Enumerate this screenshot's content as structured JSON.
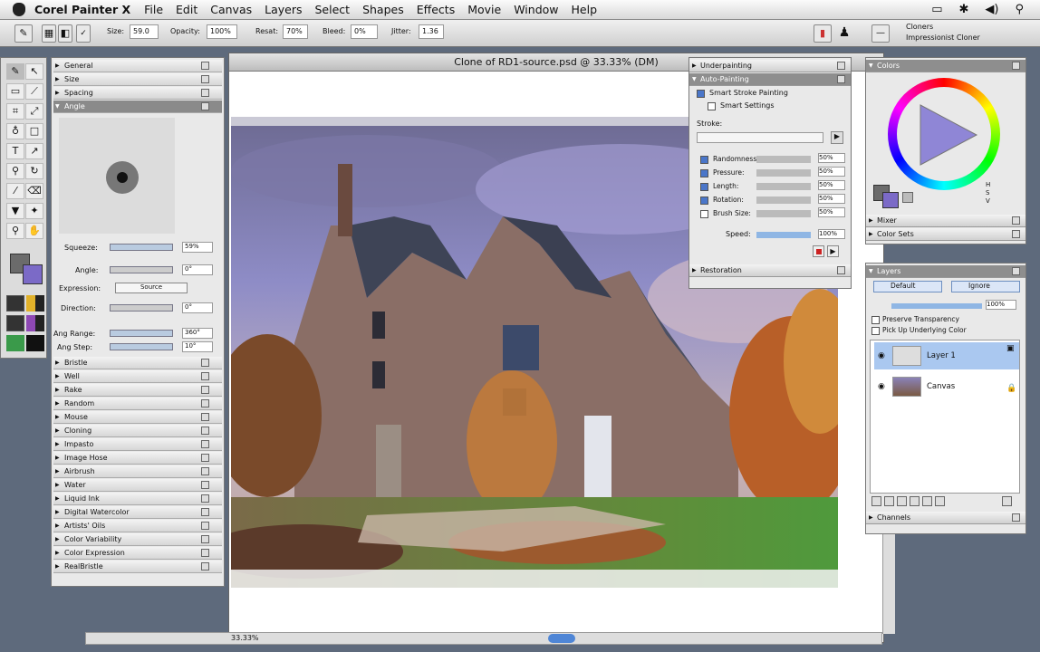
{
  "menubar": {
    "app": "Corel Painter X",
    "items": [
      "File",
      "Edit",
      "Canvas",
      "Layers",
      "Select",
      "Shapes",
      "Effects",
      "Movie",
      "Window",
      "Help"
    ]
  },
  "propbar": {
    "size_label": "Size:",
    "size_value": "59.0",
    "opacity_label": "Opacity:",
    "opacity_value": "100%",
    "resat_label": "Resat:",
    "resat_value": "70%",
    "bleed_label": "Bleed:",
    "bleed_value": "0%",
    "jitter_label": "Jitter:",
    "jitter_value": "1.36",
    "brush_category": "Cloners",
    "brush_variant": "Impressionist Cloner"
  },
  "canvas": {
    "title": "Clone of RD1-source.psd @ 33.33% (DM)",
    "zoom": "33.33%"
  },
  "brush_controls": {
    "sections_top": [
      "General",
      "Size",
      "Spacing",
      "Angle"
    ],
    "angle": {
      "squeeze_label": "Squeeze:",
      "squeeze_value": "59%",
      "angle_label": "Angle:",
      "angle_value": "0°",
      "expression_label": "Expression:",
      "expression_value": "Source",
      "direction_label": "Direction:",
      "direction_value": "0°",
      "ang_range_label": "Ang Range:",
      "ang_range_value": "360°",
      "ang_step_label": "Ang Step:",
      "ang_step_value": "10°"
    },
    "sections_bottom": [
      "Bristle",
      "Well",
      "Rake",
      "Random",
      "Mouse",
      "Cloning",
      "Impasto",
      "Image Hose",
      "Airbrush",
      "Water",
      "Liquid Ink",
      "Digital Watercolor",
      "Artists' Oils",
      "Color Variability",
      "Color Expression",
      "RealBristle"
    ]
  },
  "underpainting": {
    "title": "Underpainting",
    "auto_title": "Auto-Painting",
    "smart_stroke": "Smart Stroke Painting",
    "smart_settings": "Smart Settings",
    "stroke_label": "Stroke:",
    "rows": [
      {
        "label": "Randomness:",
        "value": "50%",
        "checked": true
      },
      {
        "label": "Pressure:",
        "value": "50%",
        "checked": true
      },
      {
        "label": "Length:",
        "value": "50%",
        "checked": true
      },
      {
        "label": "Rotation:",
        "value": "50%",
        "checked": true
      },
      {
        "label": "Brush Size:",
        "value": "50%",
        "checked": false
      }
    ],
    "speed_label": "Speed:",
    "speed_value": "100%",
    "restoration": "Restoration"
  },
  "colors": {
    "title": "Colors",
    "hsv": [
      "H",
      "S",
      "V"
    ],
    "mixer": "Mixer",
    "color_sets": "Color Sets",
    "main_color": "#6b6b6b",
    "secondary_color": "#7b6ac7"
  },
  "layers": {
    "title": "Layers",
    "composite": "Default",
    "method": "Ignore",
    "opacity": "100%",
    "preserve": "Preserve Transparency",
    "pick": "Pick Up Underlying Color",
    "items": [
      {
        "name": "Layer 1",
        "selected": true
      },
      {
        "name": "Canvas",
        "selected": false
      }
    ],
    "channels": "Channels"
  },
  "statusbar": {
    "zoom": "33.33%"
  }
}
